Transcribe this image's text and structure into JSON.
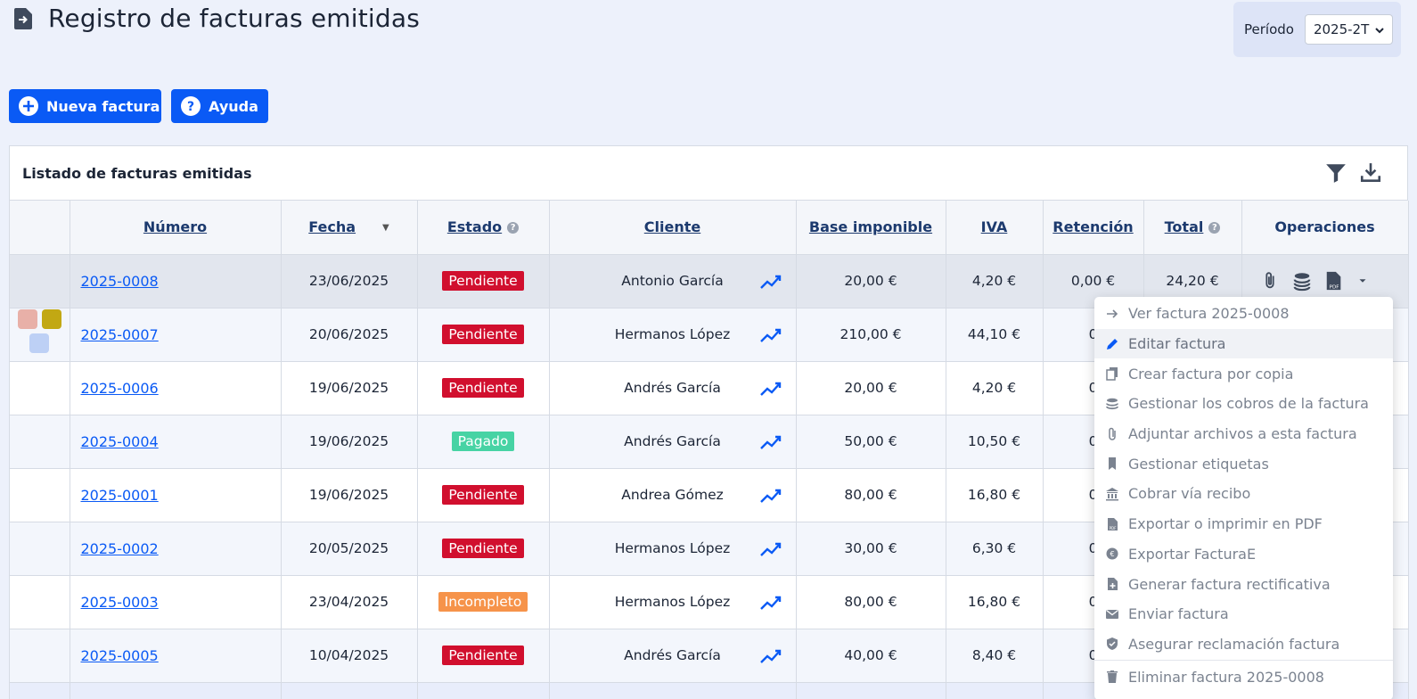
{
  "page": {
    "title": "Registro de facturas emitidas"
  },
  "period": {
    "label": "Período",
    "value": "2025-2T"
  },
  "actions": {
    "new_invoice": "Nueva factura",
    "help": "Ayuda"
  },
  "panel": {
    "title": "Listado de facturas emitidas"
  },
  "table": {
    "headers": {
      "numero": "Número",
      "fecha": "Fecha",
      "estado": "Estado",
      "cliente": "Cliente",
      "base": "Base imponible",
      "iva": "IVA",
      "retencion": "Retención",
      "total": "Total",
      "operaciones": "Operaciones"
    },
    "rows": [
      {
        "numero": "2025-0008",
        "fecha": "23/06/2025",
        "estado": "Pendiente",
        "cliente": "Antonio García",
        "base": "20,00 €",
        "iva": "4,20 €",
        "retencion": "0,00 €",
        "total": "24,20 €"
      },
      {
        "numero": "2025-0007",
        "fecha": "20/06/2025",
        "estado": "Pendiente",
        "cliente": "Hermanos López",
        "base": "210,00 €",
        "iva": "44,10 €",
        "retencion": "0",
        "total": ""
      },
      {
        "numero": "2025-0006",
        "fecha": "19/06/2025",
        "estado": "Pendiente",
        "cliente": "Andrés García",
        "base": "20,00 €",
        "iva": "4,20 €",
        "retencion": "0",
        "total": ""
      },
      {
        "numero": "2025-0004",
        "fecha": "19/06/2025",
        "estado": "Pagado",
        "cliente": "Andrés García",
        "base": "50,00 €",
        "iva": "10,50 €",
        "retencion": "0",
        "total": ""
      },
      {
        "numero": "2025-0001",
        "fecha": "19/06/2025",
        "estado": "Pendiente",
        "cliente": "Andrea Gómez",
        "base": "80,00 €",
        "iva": "16,80 €",
        "retencion": "0",
        "total": ""
      },
      {
        "numero": "2025-0002",
        "fecha": "20/05/2025",
        "estado": "Pendiente",
        "cliente": "Hermanos López",
        "base": "30,00 €",
        "iva": "6,30 €",
        "retencion": "0",
        "total": ""
      },
      {
        "numero": "2025-0003",
        "fecha": "23/04/2025",
        "estado": "Incompleto",
        "cliente": "Hermanos López",
        "base": "80,00 €",
        "iva": "16,80 €",
        "retencion": "0",
        "total": ""
      },
      {
        "numero": "2025-0005",
        "fecha": "10/04/2025",
        "estado": "Pendiente",
        "cliente": "Andrés García",
        "base": "40,00 €",
        "iva": "8,40 €",
        "retencion": "0",
        "total": ""
      }
    ]
  },
  "status_colors": {
    "Pendiente": "#d10f2e",
    "Pagado": "#47d3a4",
    "Incompleto": "#f6934a"
  },
  "tag_colors": [
    "#e8b0a8",
    "#c2a813",
    "#bdd0f5"
  ],
  "menu": {
    "items": [
      {
        "label": "Ver factura 2025-0008",
        "icon": "arrow-right-icon"
      },
      {
        "label": "Editar factura",
        "icon": "pencil-icon"
      },
      {
        "label": "Crear factura por copia",
        "icon": "copy-icon"
      },
      {
        "label": "Gestionar los cobros de la factura",
        "icon": "coins-icon"
      },
      {
        "label": "Adjuntar archivos a esta factura",
        "icon": "paperclip-icon"
      },
      {
        "label": "Gestionar etiquetas",
        "icon": "bookmark-icon"
      },
      {
        "label": "Cobrar vía recibo",
        "icon": "bank-icon"
      },
      {
        "label": "Exportar o imprimir en PDF",
        "icon": "pdf-icon"
      },
      {
        "label": "Exportar FacturaE",
        "icon": "euro-circle-icon"
      },
      {
        "label": "Generar factura rectificativa",
        "icon": "file-plus-icon"
      },
      {
        "label": "Enviar factura",
        "icon": "mail-icon"
      },
      {
        "label": "Asegurar reclamación factura",
        "icon": "shield-icon"
      },
      {
        "label": "Eliminar factura 2025-0008",
        "icon": "trash-icon"
      }
    ]
  }
}
